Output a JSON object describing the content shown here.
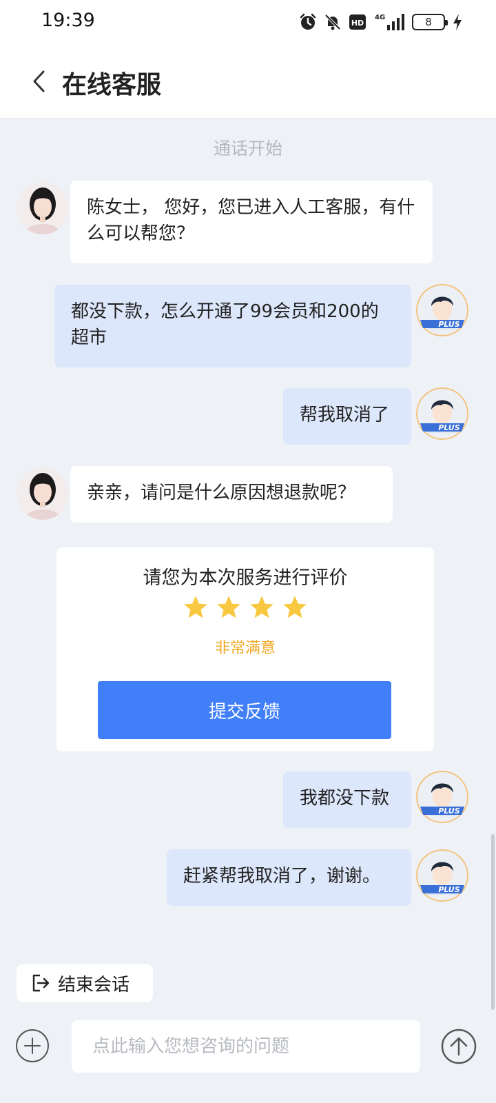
{
  "status_bar": {
    "time": "19:39",
    "icons": [
      "alarm-icon",
      "mute-bell-icon",
      "hd-icon",
      "signal-4g-icon",
      "battery-icon",
      "charging-icon"
    ],
    "hd_label": "HD",
    "network_label": "4G",
    "battery_level": "8"
  },
  "header": {
    "title": "在线客服",
    "back_icon": "chevron-left-icon"
  },
  "chat": {
    "system_note": "通话开始",
    "messages": [
      {
        "from": "agent",
        "text": "陈女士， 您好，您已进入人工客服，有什么可以帮您？"
      },
      {
        "from": "user",
        "text": "都没下款，怎么开通了99会员和200的超市"
      },
      {
        "from": "user",
        "text": "帮我取消了"
      },
      {
        "from": "agent",
        "text": "亲亲，请问是什么原因想退款呢？"
      },
      {
        "from": "user",
        "text": "我都没下款"
      },
      {
        "from": "user",
        "text": "赶紧帮我取消了，谢谢。"
      }
    ],
    "user_avatar_badge": "PLUS"
  },
  "rating_card": {
    "prompt": "请您为本次服务进行评价",
    "stars_filled": 4,
    "stars_total": 4,
    "star_color": "#f8c840",
    "label": "非常满意",
    "label_color": "#f0a928",
    "submit_label": "提交反馈",
    "submit_color": "#417ff9"
  },
  "end_session": {
    "icon": "exit-icon",
    "label": "结束会话"
  },
  "input_bar": {
    "add_icon": "plus-circle-icon",
    "placeholder": "点此输入您想咨询的问题",
    "send_icon": "arrow-up-circle-icon"
  },
  "colors": {
    "background": "#eef1f6",
    "user_bubble": "#dde7fb",
    "agent_bubble": "#ffffff"
  }
}
